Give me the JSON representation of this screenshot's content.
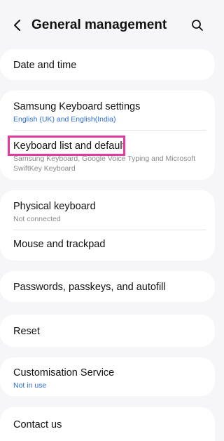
{
  "header": {
    "title": "General management",
    "back_icon": "chevron-left-icon",
    "search_icon": "search-icon"
  },
  "items": {
    "date_time": {
      "title": "Date and time"
    },
    "samsung_keyboard": {
      "title": "Samsung Keyboard settings",
      "subtitle": "English (UK) and English(India)"
    },
    "keyboard_list": {
      "title": "Keyboard list and default",
      "subtitle": "Samsung Keyboard, Google Voice Typing and Microsoft SwiftKey Keyboard"
    },
    "physical_keyboard": {
      "title": "Physical keyboard",
      "subtitle": "Not connected"
    },
    "mouse_trackpad": {
      "title": "Mouse and trackpad"
    },
    "passwords": {
      "title": "Passwords, passkeys, and autofill"
    },
    "reset": {
      "title": "Reset"
    },
    "customisation": {
      "title": "Customisation Service",
      "subtitle": "Not in use"
    },
    "contact": {
      "title": "Contact us"
    }
  },
  "colors": {
    "background": "#f6f6f8",
    "card": "#ffffff",
    "subtitle_blue": "#2e6fd6",
    "highlight": "#e5399f"
  }
}
